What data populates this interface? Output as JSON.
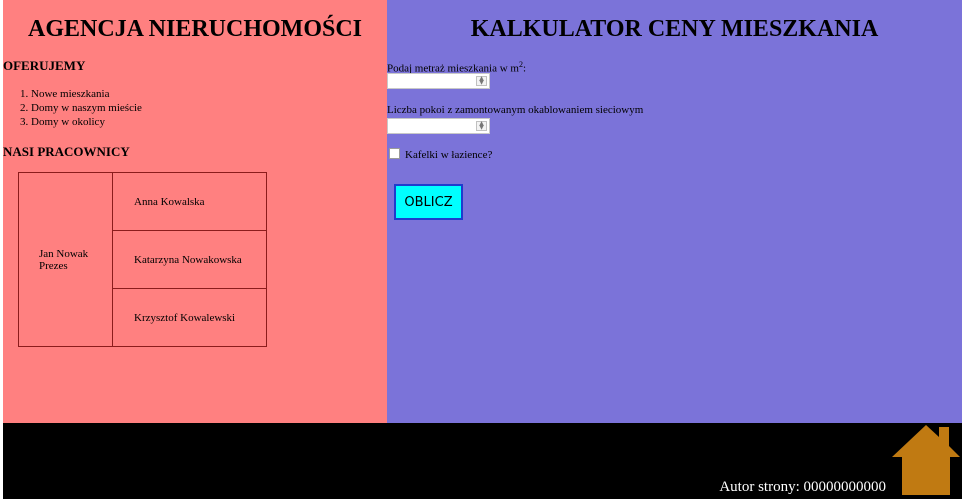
{
  "left": {
    "title": "AGENCJA NIERUCHOMOŚCI",
    "offer_heading": "OFERUJEMY",
    "offers": [
      "Nowe mieszkania",
      "Domy w naszym mieście",
      "Domy w okolicy"
    ],
    "staff_heading": "NASI PRACOWNICY",
    "boss": {
      "name": "Jan Nowak",
      "role": "Prezes"
    },
    "employees": [
      "Anna Kowalska",
      "Katarzyna Nowakowska",
      "Krzysztof Kowalewski"
    ]
  },
  "right": {
    "title": "KALKULATOR CENY MIESZKANIA",
    "area_label": "Podaj metraż mieszkania w m",
    "area_label_sup": "2",
    "area_label_suffix": ":",
    "area_value": "",
    "rooms_label": "Liczba pokoi z zamontowanym okablowaniem sieciowym",
    "rooms_value": "",
    "tiles_label": "Kafelki w łazience?",
    "calculate_button": "OBLICZ"
  },
  "footer": {
    "author": "Autor strony: 00000000000",
    "home_icon": "home-icon",
    "home_icon_color": "#c07a12"
  },
  "colors": {
    "left_bg": "#ff8080",
    "right_bg": "#7b73d9",
    "footer_bg": "#000000",
    "button_bg": "#00ffff"
  }
}
